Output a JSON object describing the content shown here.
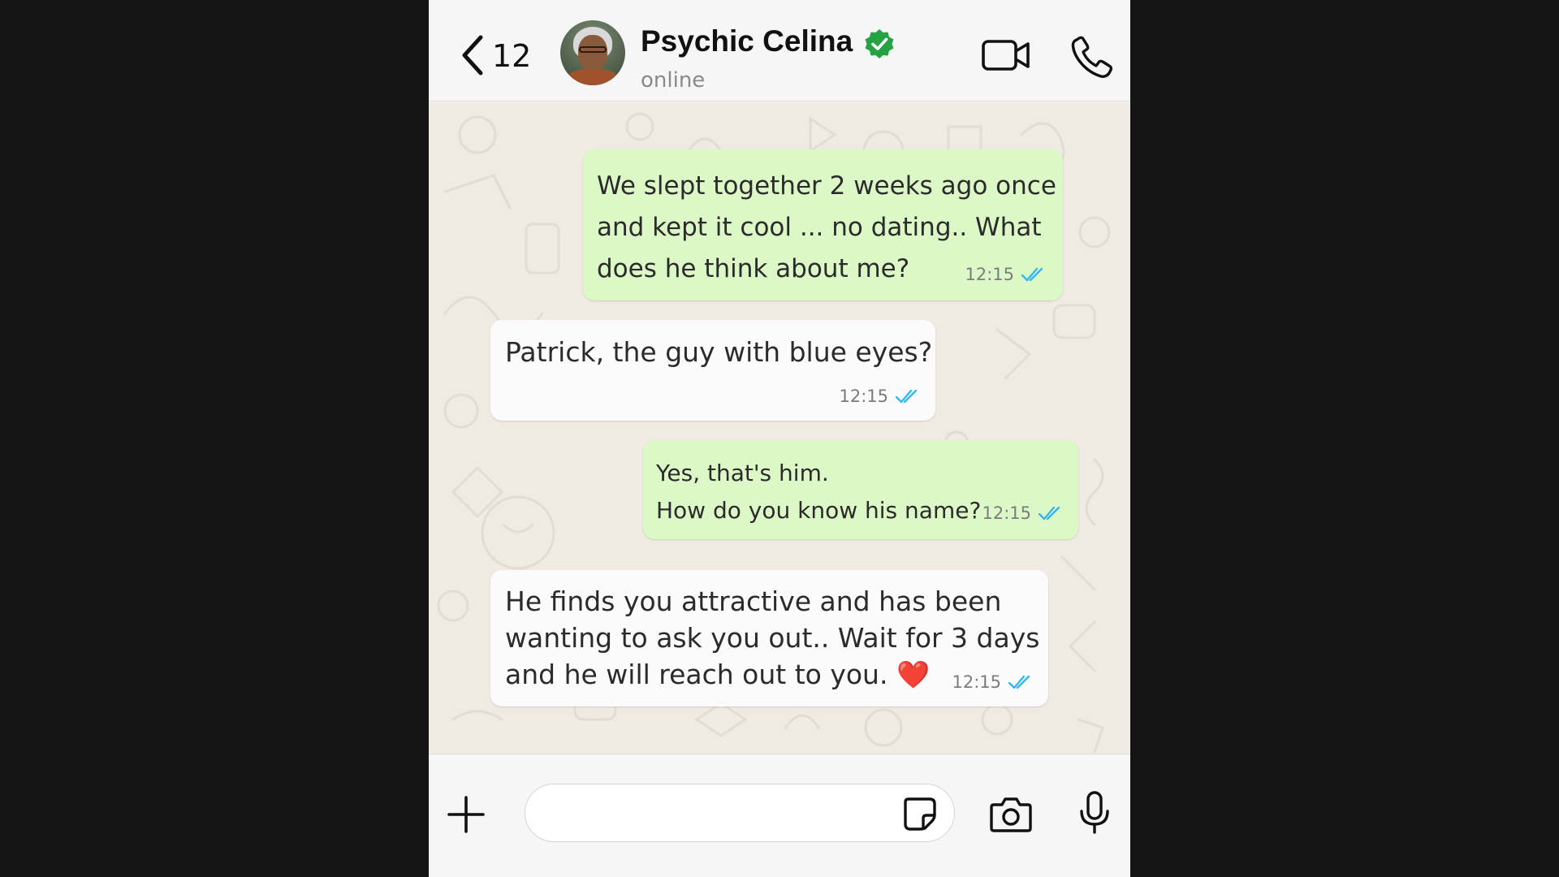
{
  "header": {
    "back_count": "12",
    "contact_name": "Psychic Celina",
    "contact_status": "online",
    "verified_icon": "verified-badge-icon",
    "video_icon": "video-camera-icon",
    "call_icon": "phone-icon"
  },
  "messages": [
    {
      "direction": "outgoing",
      "text": "We slept together 2 weeks ago once\nand kept it cool ... no dating.. What\ndoes he think about me?",
      "time": "12:15",
      "status": "read"
    },
    {
      "direction": "incoming",
      "text": "Patrick, the guy with blue eyes?",
      "time": "12:15",
      "status": "read"
    },
    {
      "direction": "outgoing",
      "text": "Yes, that's him.\nHow do you know his name?",
      "time": "12:15",
      "status": "read"
    },
    {
      "direction": "incoming",
      "text": "He finds you attractive and has been\nwanting to ask you out..  Wait for 3 days\nand he will reach out to you. ❤️",
      "time": "12:15",
      "status": "read"
    }
  ],
  "composer": {
    "value": "",
    "placeholder": "",
    "plus_icon": "plus-icon",
    "sticker_icon": "sticker-icon",
    "camera_icon": "camera-icon",
    "mic_icon": "microphone-icon"
  },
  "colors": {
    "outgoing_bubble": "#dcf8c6",
    "incoming_bubble": "#fbfbfb",
    "chat_background": "#efeae2",
    "read_ticks": "#34b7f1",
    "verified_badge": "#25a244"
  }
}
